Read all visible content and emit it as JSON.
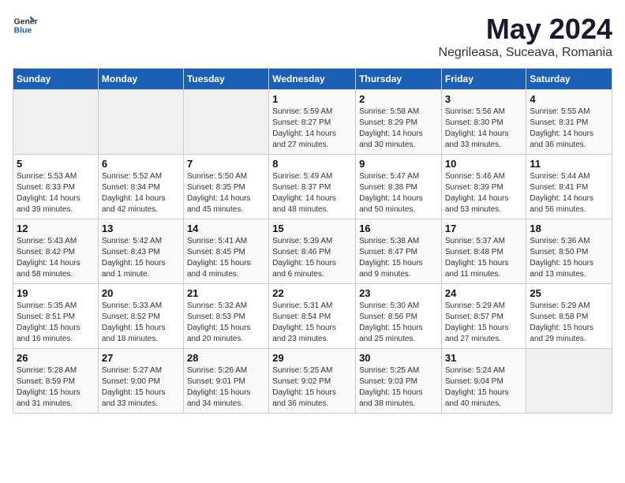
{
  "logo": {
    "text_general": "General",
    "text_blue": "Blue"
  },
  "title": {
    "month_year": "May 2024",
    "location": "Negrileasa, Suceava, Romania"
  },
  "weekdays": [
    "Sunday",
    "Monday",
    "Tuesday",
    "Wednesday",
    "Thursday",
    "Friday",
    "Saturday"
  ],
  "weeks": [
    [
      {
        "day": "",
        "info": ""
      },
      {
        "day": "",
        "info": ""
      },
      {
        "day": "",
        "info": ""
      },
      {
        "day": "1",
        "info": "Sunrise: 5:59 AM\nSunset: 8:27 PM\nDaylight: 14 hours\nand 27 minutes."
      },
      {
        "day": "2",
        "info": "Sunrise: 5:58 AM\nSunset: 8:29 PM\nDaylight: 14 hours\nand 30 minutes."
      },
      {
        "day": "3",
        "info": "Sunrise: 5:56 AM\nSunset: 8:30 PM\nDaylight: 14 hours\nand 33 minutes."
      },
      {
        "day": "4",
        "info": "Sunrise: 5:55 AM\nSunset: 8:31 PM\nDaylight: 14 hours\nand 36 minutes."
      }
    ],
    [
      {
        "day": "5",
        "info": "Sunrise: 5:53 AM\nSunset: 8:33 PM\nDaylight: 14 hours\nand 39 minutes."
      },
      {
        "day": "6",
        "info": "Sunrise: 5:52 AM\nSunset: 8:34 PM\nDaylight: 14 hours\nand 42 minutes."
      },
      {
        "day": "7",
        "info": "Sunrise: 5:50 AM\nSunset: 8:35 PM\nDaylight: 14 hours\nand 45 minutes."
      },
      {
        "day": "8",
        "info": "Sunrise: 5:49 AM\nSunset: 8:37 PM\nDaylight: 14 hours\nand 48 minutes."
      },
      {
        "day": "9",
        "info": "Sunrise: 5:47 AM\nSunset: 8:38 PM\nDaylight: 14 hours\nand 50 minutes."
      },
      {
        "day": "10",
        "info": "Sunrise: 5:46 AM\nSunset: 8:39 PM\nDaylight: 14 hours\nand 53 minutes."
      },
      {
        "day": "11",
        "info": "Sunrise: 5:44 AM\nSunset: 8:41 PM\nDaylight: 14 hours\nand 56 minutes."
      }
    ],
    [
      {
        "day": "12",
        "info": "Sunrise: 5:43 AM\nSunset: 8:42 PM\nDaylight: 14 hours\nand 58 minutes."
      },
      {
        "day": "13",
        "info": "Sunrise: 5:42 AM\nSunset: 8:43 PM\nDaylight: 15 hours\nand 1 minute."
      },
      {
        "day": "14",
        "info": "Sunrise: 5:41 AM\nSunset: 8:45 PM\nDaylight: 15 hours\nand 4 minutes."
      },
      {
        "day": "15",
        "info": "Sunrise: 5:39 AM\nSunset: 8:46 PM\nDaylight: 15 hours\nand 6 minutes."
      },
      {
        "day": "16",
        "info": "Sunrise: 5:38 AM\nSunset: 8:47 PM\nDaylight: 15 hours\nand 9 minutes."
      },
      {
        "day": "17",
        "info": "Sunrise: 5:37 AM\nSunset: 8:48 PM\nDaylight: 15 hours\nand 11 minutes."
      },
      {
        "day": "18",
        "info": "Sunrise: 5:36 AM\nSunset: 8:50 PM\nDaylight: 15 hours\nand 13 minutes."
      }
    ],
    [
      {
        "day": "19",
        "info": "Sunrise: 5:35 AM\nSunset: 8:51 PM\nDaylight: 15 hours\nand 16 minutes."
      },
      {
        "day": "20",
        "info": "Sunrise: 5:33 AM\nSunset: 8:52 PM\nDaylight: 15 hours\nand 18 minutes."
      },
      {
        "day": "21",
        "info": "Sunrise: 5:32 AM\nSunset: 8:53 PM\nDaylight: 15 hours\nand 20 minutes."
      },
      {
        "day": "22",
        "info": "Sunrise: 5:31 AM\nSunset: 8:54 PM\nDaylight: 15 hours\nand 23 minutes."
      },
      {
        "day": "23",
        "info": "Sunrise: 5:30 AM\nSunset: 8:56 PM\nDaylight: 15 hours\nand 25 minutes."
      },
      {
        "day": "24",
        "info": "Sunrise: 5:29 AM\nSunset: 8:57 PM\nDaylight: 15 hours\nand 27 minutes."
      },
      {
        "day": "25",
        "info": "Sunrise: 5:29 AM\nSunset: 8:58 PM\nDaylight: 15 hours\nand 29 minutes."
      }
    ],
    [
      {
        "day": "26",
        "info": "Sunrise: 5:28 AM\nSunset: 8:59 PM\nDaylight: 15 hours\nand 31 minutes."
      },
      {
        "day": "27",
        "info": "Sunrise: 5:27 AM\nSunset: 9:00 PM\nDaylight: 15 hours\nand 33 minutes."
      },
      {
        "day": "28",
        "info": "Sunrise: 5:26 AM\nSunset: 9:01 PM\nDaylight: 15 hours\nand 34 minutes."
      },
      {
        "day": "29",
        "info": "Sunrise: 5:25 AM\nSunset: 9:02 PM\nDaylight: 15 hours\nand 36 minutes."
      },
      {
        "day": "30",
        "info": "Sunrise: 5:25 AM\nSunset: 9:03 PM\nDaylight: 15 hours\nand 38 minutes."
      },
      {
        "day": "31",
        "info": "Sunrise: 5:24 AM\nSunset: 9:04 PM\nDaylight: 15 hours\nand 40 minutes."
      },
      {
        "day": "",
        "info": ""
      }
    ]
  ]
}
